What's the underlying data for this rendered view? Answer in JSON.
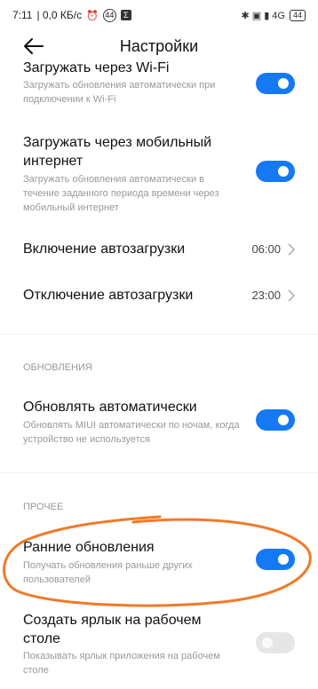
{
  "status": {
    "time": "7:11",
    "speed": "| 0,0 КБ/с",
    "left_badge": "44",
    "right_indicators": "✱ ▣ ▮ 4G",
    "battery": "44"
  },
  "header": {
    "title": "Настройки"
  },
  "rows": [
    {
      "title": "Загружать через Wi-Fi",
      "subtitle": "Загружать обновления автоматически при подключении к Wi-Fi",
      "toggle": "on"
    },
    {
      "title": "Загружать через мобильный интернет",
      "subtitle": "Загружать обновления автоматически в течение заданного периода времени через мобильный интернет",
      "toggle": "on"
    },
    {
      "title": "Включение автозагрузки",
      "value": "06:00"
    },
    {
      "title": "Отключение автозагрузки",
      "value": "23:00"
    }
  ],
  "sections": {
    "updates": "ОБНОВЛЕНИЯ",
    "other": "ПРОЧЕЕ"
  },
  "update_rows": [
    {
      "title": "Обновлять автоматически",
      "subtitle": "Обновлять MIUI автоматически по ночам, когда устройство не используется",
      "toggle": "on"
    }
  ],
  "other_rows": [
    {
      "title": "Ранние обновления",
      "subtitle": "Получать обновления раньше других пользователей",
      "toggle": "on"
    },
    {
      "title": "Создать ярлык на рабочем столе",
      "subtitle": "Показывать ярлык приложения на рабочем столе",
      "toggle": "off"
    }
  ],
  "colors": {
    "accent": "#1578f5",
    "annotation": "#f07a2a",
    "toggle_off": "#e6e6e6"
  }
}
